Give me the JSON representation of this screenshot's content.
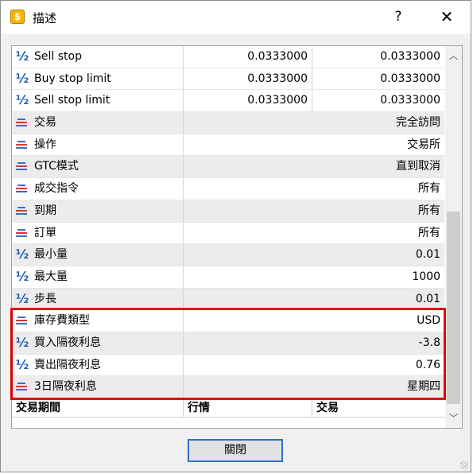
{
  "window": {
    "title": "描述",
    "help_label": "?",
    "close_label": "✕",
    "app_icon_glyph": "$",
    "close_button_label": "關閉"
  },
  "icons": {
    "half": "½",
    "half_icon_name": "number-fraction-icon",
    "lines_icon_name": "text-property-icon"
  },
  "rows": [
    {
      "icon": "half",
      "name": "Sell stop",
      "v2": "0.0333000",
      "v3": "0.0333000",
      "alt": false
    },
    {
      "icon": "half",
      "name": "Buy stop limit",
      "v2": "0.0333000",
      "v3": "0.0333000",
      "alt": false
    },
    {
      "icon": "half",
      "name": "Sell stop limit",
      "v2": "0.0333000",
      "v3": "0.0333000",
      "alt": false
    },
    {
      "icon": "lines",
      "name": "交易",
      "value": "完全訪問",
      "alt": true
    },
    {
      "icon": "lines",
      "name": "操作",
      "value": "交易所",
      "alt": false
    },
    {
      "icon": "lines",
      "name": "GTC模式",
      "value": "直到取消",
      "alt": true
    },
    {
      "icon": "lines",
      "name": "成交指令",
      "value": "所有",
      "alt": false
    },
    {
      "icon": "lines",
      "name": "到期",
      "value": "所有",
      "alt": true
    },
    {
      "icon": "lines",
      "name": "訂單",
      "value": "所有",
      "alt": false
    },
    {
      "icon": "half",
      "name": "最小量",
      "value": "0.01",
      "alt": true
    },
    {
      "icon": "half",
      "name": "最大量",
      "value": "1000",
      "alt": false
    },
    {
      "icon": "half",
      "name": "步長",
      "value": "0.01",
      "alt": true
    },
    {
      "icon": "lines",
      "name": "庫存費類型",
      "value": "USD",
      "alt": false
    },
    {
      "icon": "half",
      "name": "買入隔夜利息",
      "value": "-3.8",
      "alt": true
    },
    {
      "icon": "half",
      "name": "賣出隔夜利息",
      "value": "0.76",
      "alt": false
    },
    {
      "icon": "lines",
      "name": "3日隔夜利息",
      "value": "星期四",
      "alt": true
    }
  ],
  "section_header": {
    "col1": "交易期間",
    "col2": "行情",
    "col3": "交易"
  },
  "scrollbar": {
    "up": "︿",
    "down": "﹀"
  },
  "colors": {
    "highlight": "#e00000",
    "accent": "#2f6fd0"
  }
}
